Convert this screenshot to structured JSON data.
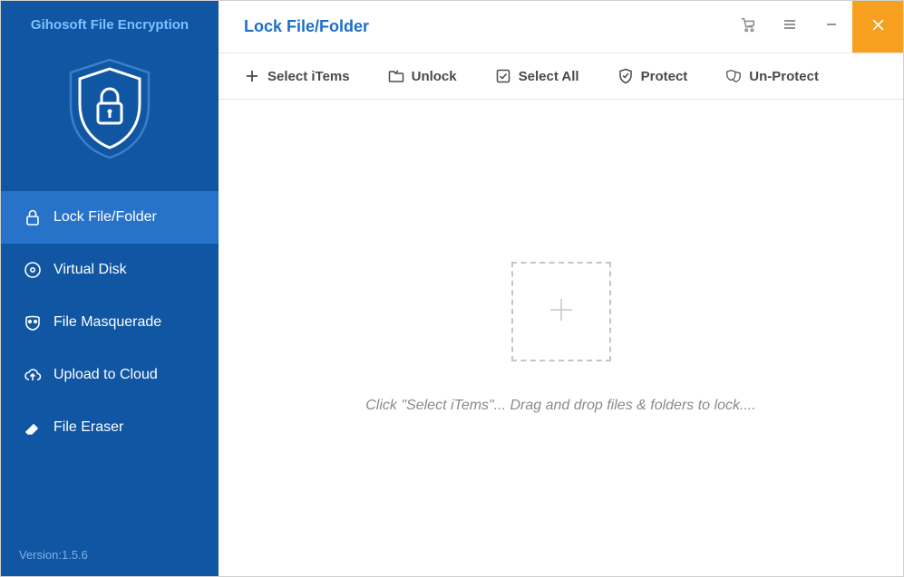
{
  "app_title": "Gihosoft File Encryption",
  "version_label": "Version:1.5.6",
  "sidebar": {
    "items": [
      {
        "label": "Lock File/Folder",
        "icon": "lock-icon",
        "active": true
      },
      {
        "label": "Virtual Disk",
        "icon": "disc-icon"
      },
      {
        "label": "File Masquerade",
        "icon": "mask-icon"
      },
      {
        "label": "Upload to Cloud",
        "icon": "cloud-icon"
      },
      {
        "label": "File Eraser",
        "icon": "eraser-icon"
      }
    ]
  },
  "header": {
    "title": "Lock File/Folder"
  },
  "toolbar": {
    "select_label": "Select iTems",
    "unlock_label": "Unlock",
    "select_all_label": "Select All",
    "protect_label": "Protect",
    "unprotect_label": "Un-Protect"
  },
  "content": {
    "hint": "Click \"Select iTems\"... Drag and drop files & folders to lock...."
  },
  "colors": {
    "sidebar_bg": "#1056a3",
    "sidebar_active": "#2773c9",
    "accent_blue": "#1e6fc9",
    "close_orange": "#f7a01f"
  }
}
